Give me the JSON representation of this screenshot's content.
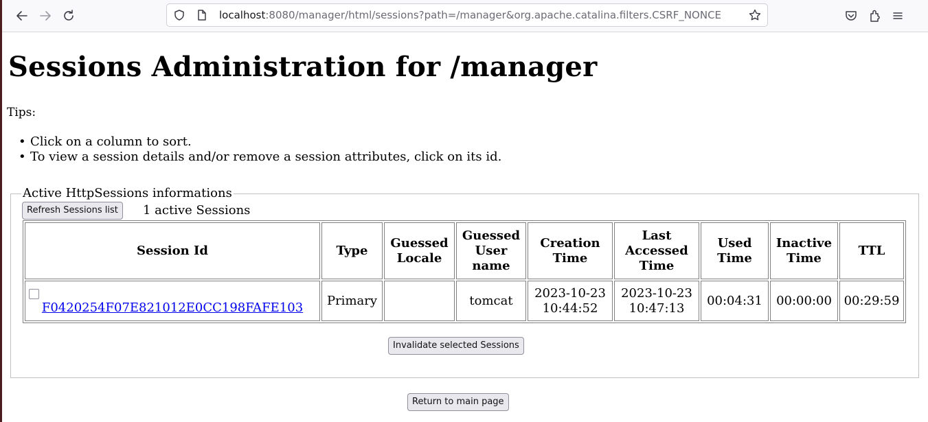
{
  "browser": {
    "url_host": "localhost",
    "url_rest": ":8080/manager/html/sessions?path=/manager&org.apache.catalina.filters.CSRF_NONCE"
  },
  "page": {
    "title": "Sessions Administration for /manager",
    "tips_label": "Tips:",
    "tips": [
      "Click on a column to sort.",
      "To view a session details and/or remove a session attributes, click on its id."
    ]
  },
  "sessions_box": {
    "legend": "Active HttpSessions informations",
    "refresh_label": "Refresh Sessions list",
    "active_count": "1 active Sessions",
    "headers": {
      "session_id": "Session Id",
      "type": "Type",
      "guessed_locale": [
        "Guessed",
        "Locale"
      ],
      "guessed_user": [
        "Guessed",
        "User",
        "name"
      ],
      "creation_time": [
        "Creation",
        "Time"
      ],
      "last_accessed": [
        "Last",
        "Accessed",
        "Time"
      ],
      "used_time": [
        "Used",
        "Time"
      ],
      "inactive_time": [
        "Inactive",
        "Time"
      ],
      "ttl": "TTL"
    },
    "rows": [
      {
        "session_id": "F0420254F07E821012E0CC198FAFE103",
        "type": "Primary",
        "locale": "",
        "user": "tomcat",
        "creation_date": "2023-10-23",
        "creation_time": "10:44:52",
        "last_date": "2023-10-23",
        "last_time": "10:47:13",
        "used": "00:04:31",
        "inactive": "00:00:00",
        "ttl": "00:29:59"
      }
    ],
    "invalidate_label": "Invalidate selected Sessions"
  },
  "return_label": "Return to main page",
  "colors": {
    "link": "#0000ee",
    "button_bg": "#e9e9ed"
  }
}
